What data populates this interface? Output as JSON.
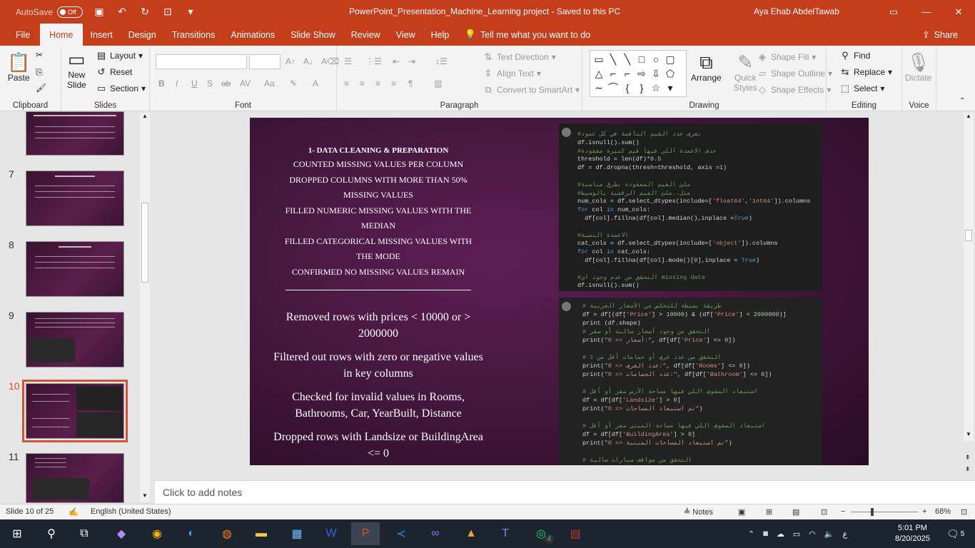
{
  "titlebar": {
    "autosave_label": "AutoSave",
    "autosave_state": "Off",
    "document_title": "PowerPoint_Presentation_Machine_Learning project  -  Saved to this PC",
    "user": "Aya Ehab AbdelTawab"
  },
  "tabs": [
    "File",
    "Home",
    "Insert",
    "Design",
    "Transitions",
    "Animations",
    "Slide Show",
    "Review",
    "View",
    "Help"
  ],
  "active_tab": "Home",
  "tell_me": "Tell me what you want to do",
  "share_label": "Share",
  "ribbon": {
    "clipboard": {
      "label": "Clipboard",
      "paste": "Paste"
    },
    "slides": {
      "label": "Slides",
      "new_slide": "New",
      "new_slide2": "Slide",
      "layout": "Layout",
      "reset": "Reset",
      "section": "Section"
    },
    "font": {
      "label": "Font"
    },
    "paragraph": {
      "label": "Paragraph",
      "text_direction": "Text Direction",
      "align_text": "Align Text",
      "smartart": "Convert to SmartArt"
    },
    "drawing": {
      "label": "Drawing",
      "arrange": "Arrange",
      "quick_styles": "Quick",
      "quick_styles2": "Styles",
      "shape_fill": "Shape Fill",
      "shape_outline": "Shape Outline",
      "shape_effects": "Shape Effects"
    },
    "editing": {
      "label": "Editing",
      "find": "Find",
      "replace": "Replace",
      "select": "Select"
    },
    "voice": {
      "label": "Voice",
      "dictate": "Dictate"
    }
  },
  "thumbnails": [
    {
      "num": "7"
    },
    {
      "num": "8"
    },
    {
      "num": "9"
    },
    {
      "num": "10"
    },
    {
      "num": "11"
    }
  ],
  "slide": {
    "heading": "1- DATA CLEANING & PREPARATION",
    "lines": [
      "COUNTED MISSING VALUES PER COLUMN",
      "DROPPED COLUMNS WITH MORE THAN 50%",
      "MISSING VALUES",
      "FILLED NUMERIC MISSING VALUES WITH THE",
      "MEDIAN",
      "FILLED CATEGORICAL MISSING VALUES WITH",
      "THE MODE",
      "CONFIRMED NO MISSING VALUES REMAIN"
    ],
    "bullets": [
      "Removed rows with prices < 10000 or > 2000000",
      "Filtered out rows with zero or negative values in key columns",
      "Checked for invalid values in Rooms, Bathrooms, Car, YearBuilt, Distance",
      "Dropped rows with Landsize or BuildingArea <= 0"
    ]
  },
  "notes_placeholder": "Click to add notes",
  "status": {
    "slide_of": "Slide 10 of 25",
    "language": "English (United States)",
    "notes": "Notes",
    "zoom": "68%"
  },
  "taskbar": {
    "time": "5:01 PM",
    "date": "8/20/2025",
    "notification_count": "5",
    "whatsapp_badge": "4",
    "lang": "ع"
  }
}
